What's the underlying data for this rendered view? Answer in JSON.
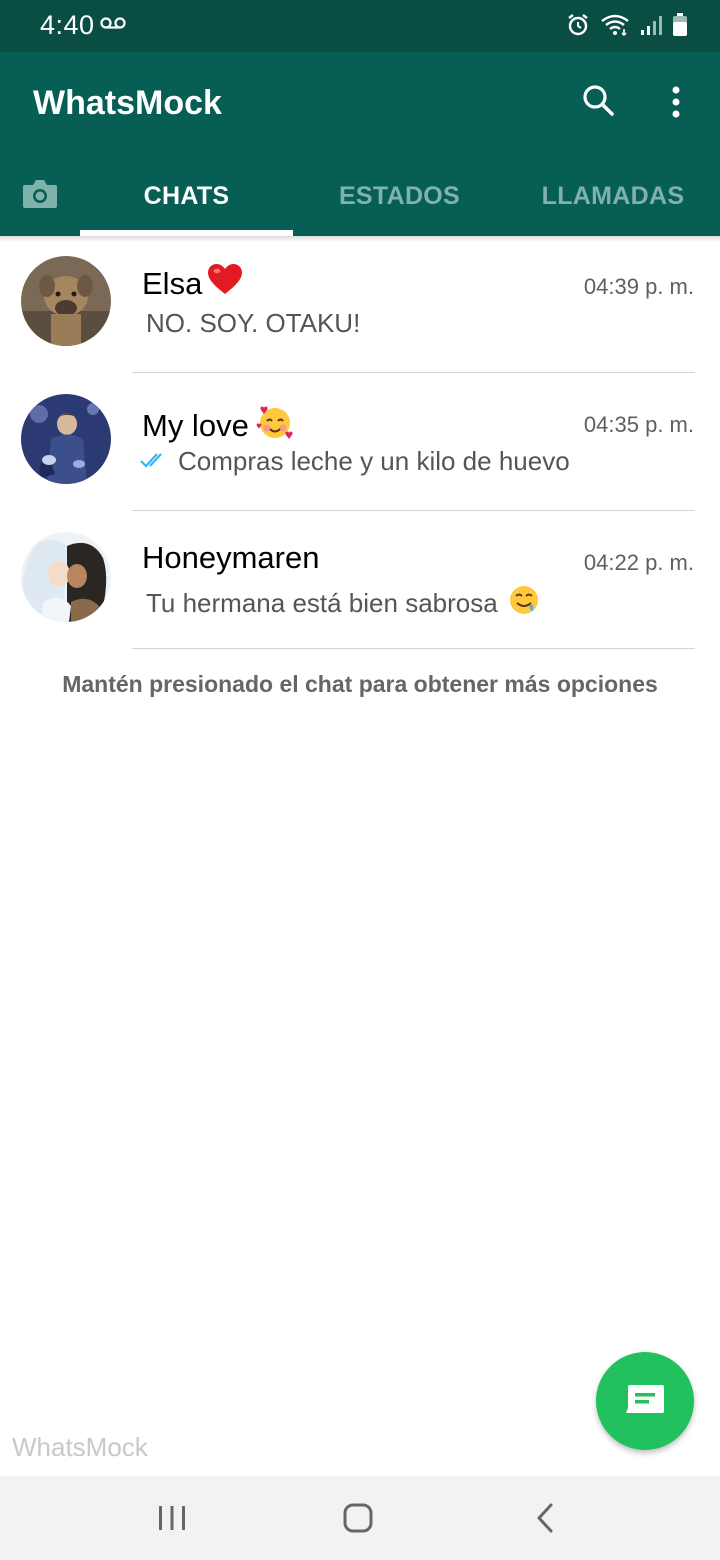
{
  "status_bar": {
    "time": "4:40",
    "icons": [
      "voicemail-icon",
      "alarm-icon",
      "wifi-icon",
      "signal-icon",
      "battery-icon"
    ]
  },
  "header": {
    "title": "WhatsMock",
    "icons": [
      "search-icon",
      "more-vert-icon"
    ]
  },
  "tabs": [
    {
      "icon": "camera-icon"
    },
    {
      "label": "CHATS",
      "active": true
    },
    {
      "label": "ESTADOS",
      "active": false
    },
    {
      "label": "LLAMADAS",
      "active": false
    }
  ],
  "chats": [
    {
      "name": "Elsa",
      "name_emoji": "❤️",
      "time": "04:39 p. m.",
      "message": "NO. SOY. OTAKU!",
      "read_ticks": false
    },
    {
      "name": "My love",
      "name_emoji": "🥰",
      "time": "04:35 p. m.",
      "message": "Compras leche y un kilo de huevo",
      "read_ticks": true
    },
    {
      "name": "Honeymaren",
      "name_emoji": "",
      "time": "04:22 p. m.",
      "message": "Tu hermana está bien sabrosa",
      "message_emoji": "🤤",
      "read_ticks": false
    }
  ],
  "hint": "Mantén presionado el chat para obtener más opciones",
  "watermark": "WhatsMock",
  "fab": {
    "icon": "new-chat-icon"
  },
  "nav_bar": {
    "icons": [
      "recents-icon",
      "home-icon",
      "back-icon"
    ]
  },
  "colors": {
    "header": "#075e54",
    "status_bar": "#0a4d43",
    "fab": "#22c15e",
    "read_tick": "#34b7f1"
  }
}
